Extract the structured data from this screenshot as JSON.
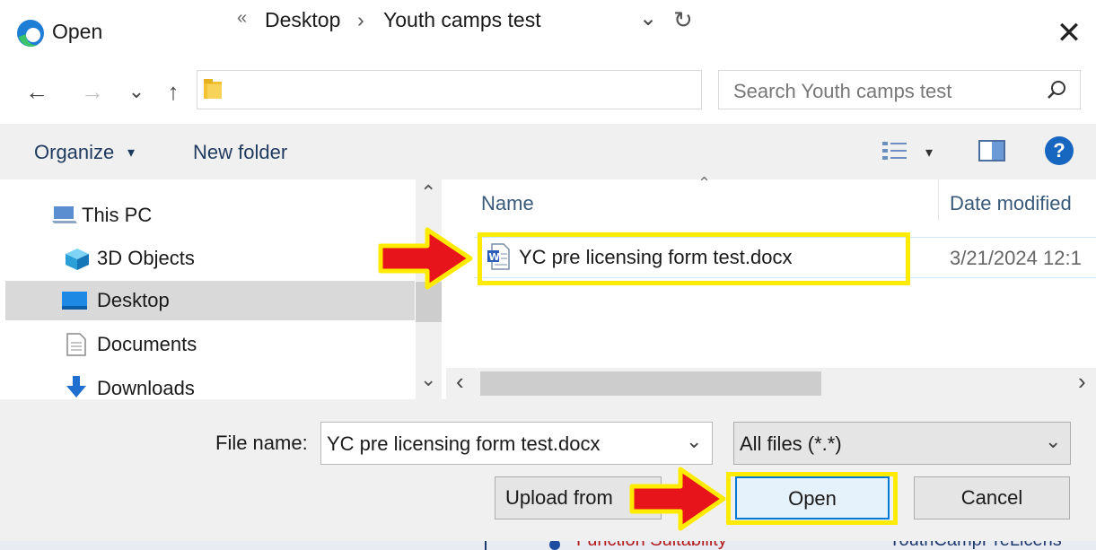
{
  "window": {
    "title": "Open",
    "close_glyph": "✕"
  },
  "nav": {
    "back": "←",
    "forward": "→",
    "recent": "⌄",
    "up": "↑",
    "breadcrumb_overflow": "«",
    "breadcrumb": [
      "Desktop",
      "Youth camps test"
    ],
    "separator": "›",
    "dropdown_glyph": "⌄",
    "refresh_glyph": "↻"
  },
  "search": {
    "placeholder": "Search Youth camps test",
    "icon_glyph": "⚲"
  },
  "toolbar": {
    "organize_label": "Organize",
    "organize_caret": "▾",
    "new_folder_label": "New folder",
    "view_caret": "▾",
    "help_label": "?"
  },
  "sidebar": {
    "scroll_up": "⌃",
    "scroll_down": "⌄",
    "items": [
      {
        "label": "This PC",
        "icon": "computer-icon"
      },
      {
        "label": "3D Objects",
        "icon": "3d-objects-icon"
      },
      {
        "label": "Desktop",
        "icon": "desktop-icon",
        "selected": true
      },
      {
        "label": "Documents",
        "icon": "documents-icon"
      },
      {
        "label": "Downloads",
        "icon": "downloads-icon"
      }
    ]
  },
  "file_list": {
    "columns": [
      "Name",
      "Date modified"
    ],
    "sort_glyph": "⌃",
    "rows": [
      {
        "name": "YC pre licensing form test.docx",
        "date": "3/21/2024 12:1",
        "icon": "word-document-icon"
      }
    ],
    "scroll_left": "‹",
    "scroll_right": "›"
  },
  "bottom": {
    "file_name_label": "File name:",
    "file_name_value": "YC pre licensing form test.docx",
    "filter_value": "All files (*.*)",
    "upload_label": "Upload from",
    "open_label": "Open",
    "cancel_label": "Cancel"
  },
  "annotations": {
    "highlight_color": "#FFEB00",
    "arrow_color": "#E8141B"
  },
  "background_strip": {
    "left_text": "Function Suitability",
    "right_text": "YouthCampPreLicens"
  }
}
